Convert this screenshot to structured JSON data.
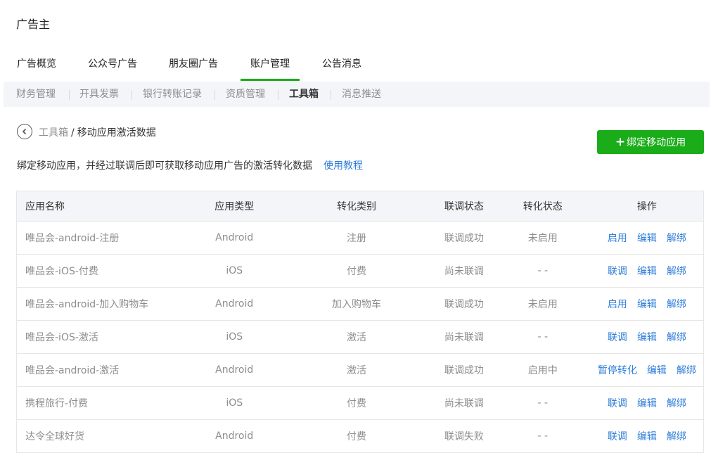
{
  "page_title": "广告主",
  "main_nav": [
    "广告概览",
    "公众号广告",
    "朋友圈广告",
    "账户管理",
    "公告消息"
  ],
  "sub_nav": [
    "财务管理",
    "开具发票",
    "银行转账记录",
    "资质管理",
    "工具箱",
    "消息推送"
  ],
  "breadcrumb": {
    "parent": "工具箱",
    "separator": "/",
    "current": "移动应用激活数据"
  },
  "bind_button": {
    "plus": "+",
    "label": "绑定移动应用"
  },
  "description": {
    "text": "绑定移动应用，并经过联调后即可获取移动应用广告的激活转化数据",
    "link": "使用教程"
  },
  "table": {
    "headers": [
      "应用名称",
      "应用类型",
      "转化类别",
      "联调状态",
      "转化状态",
      "操作"
    ],
    "rows": [
      {
        "name": "唯品会-android-注册",
        "type": "Android",
        "category": "注册",
        "debug": "联调成功",
        "status": "未启用",
        "ops": [
          "启用",
          "编辑",
          "解绑"
        ]
      },
      {
        "name": "唯品会-iOS-付费",
        "type": "iOS",
        "category": "付费",
        "debug": "尚未联调",
        "status": "- -",
        "ops": [
          "联调",
          "编辑",
          "解绑"
        ]
      },
      {
        "name": "唯品会-android-加入购物车",
        "type": "Android",
        "category": "加入购物车",
        "debug": "联调成功",
        "status": "未启用",
        "ops": [
          "启用",
          "编辑",
          "解绑"
        ]
      },
      {
        "name": "唯品会-iOS-激活",
        "type": "iOS",
        "category": "激活",
        "debug": "尚未联调",
        "status": "- -",
        "ops": [
          "联调",
          "编辑",
          "解绑"
        ]
      },
      {
        "name": "唯品会-android-激活",
        "type": "Android",
        "category": "激活",
        "debug": "联调成功",
        "status": "启用中",
        "ops": [
          "暂停转化",
          "编辑",
          "解绑"
        ]
      },
      {
        "name": "携程旅行-付费",
        "type": "iOS",
        "category": "付费",
        "debug": "尚未联调",
        "status": "- -",
        "ops": [
          "联调",
          "编辑",
          "解绑"
        ]
      },
      {
        "name": "达令全球好货",
        "type": "Android",
        "category": "付费",
        "debug": "联调失败",
        "status": "- -",
        "ops": [
          "联调",
          "编辑",
          "解绑"
        ]
      }
    ]
  },
  "colors": {
    "accent": "#1AAD19",
    "link": "#2F7ED8",
    "muted": "#8d8d8d"
  },
  "icons": {
    "back": "chevron-left-circle-icon"
  }
}
